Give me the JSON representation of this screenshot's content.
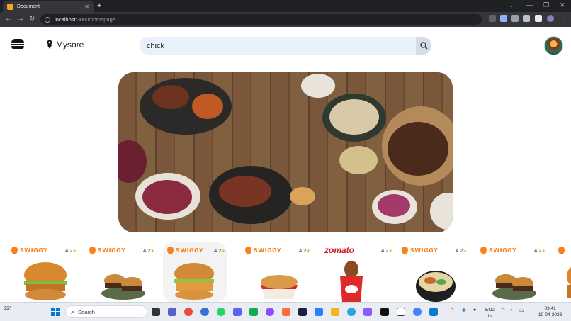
{
  "browser": {
    "tab_title": "Document",
    "url_host": "localhost",
    "url_path": ":3000/homepage"
  },
  "header": {
    "location": "Mysore",
    "search_value": "chick"
  },
  "cards": [
    {
      "brand": "SWIGGY",
      "brand_type": "swiggy",
      "rating": "4.2",
      "food": "chicken-burger"
    },
    {
      "brand": "SWIGGY",
      "brand_type": "swiggy",
      "rating": "4.2",
      "food": "sliders"
    },
    {
      "brand": "SWIGGY",
      "brand_type": "swiggy",
      "rating": "4.2",
      "food": "crispy-burger"
    },
    {
      "brand": "SWIGGY",
      "brand_type": "swiggy",
      "rating": "4.2",
      "food": "popcorn-chicken"
    },
    {
      "brand": "zomato",
      "brand_type": "zomato",
      "rating": "4.2",
      "food": "chicken-bucket"
    },
    {
      "brand": "SWIGGY",
      "brand_type": "swiggy",
      "rating": "4.2",
      "food": "rice-bowl"
    },
    {
      "brand": "SWIGGY",
      "brand_type": "swiggy",
      "rating": "4.2",
      "food": "sliders"
    }
  ],
  "taskbar": {
    "weather": "22°",
    "search_label": "Search",
    "lang": "ENG",
    "region": "IN",
    "time": "03:41",
    "date": "10-04-2023"
  },
  "colors": {
    "swiggy": "#fc8019",
    "zomato": "#cb202d",
    "search_bg": "#e8f0fb"
  }
}
